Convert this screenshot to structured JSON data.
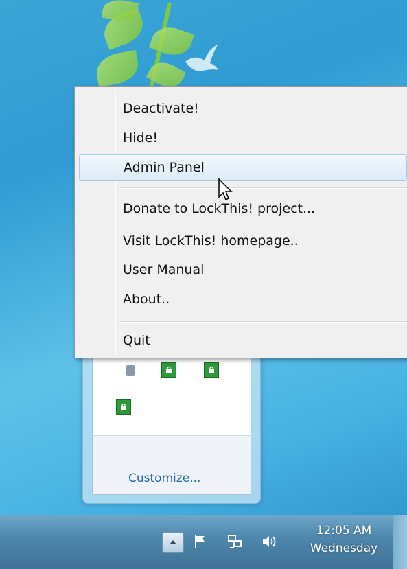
{
  "menu": {
    "items": [
      {
        "label": "Deactivate!"
      },
      {
        "label": "Hide!"
      },
      {
        "label": "Admin Panel"
      },
      {
        "label": "Donate to LockThis! project..."
      },
      {
        "label": "Visit LockThis! homepage.."
      },
      {
        "label": "User Manual"
      },
      {
        "label": "About.."
      },
      {
        "label": "Quit"
      }
    ],
    "selected": "Admin Panel"
  },
  "tray": {
    "customize_label": "Customize...",
    "icons": [
      "tray-app-icon",
      "lock-icon",
      "lock-icon",
      "lock-icon"
    ]
  },
  "taskbar": {
    "time": "12:05 AM",
    "day": "Wednesday",
    "icons": [
      "show-hidden-icons-icon",
      "action-center-flag-icon",
      "network-icon",
      "volume-icon"
    ]
  },
  "colors": {
    "menu_highlight": "#dcebf8",
    "lock_green": "#2f9a3a",
    "link_blue": "#1e67b3"
  }
}
